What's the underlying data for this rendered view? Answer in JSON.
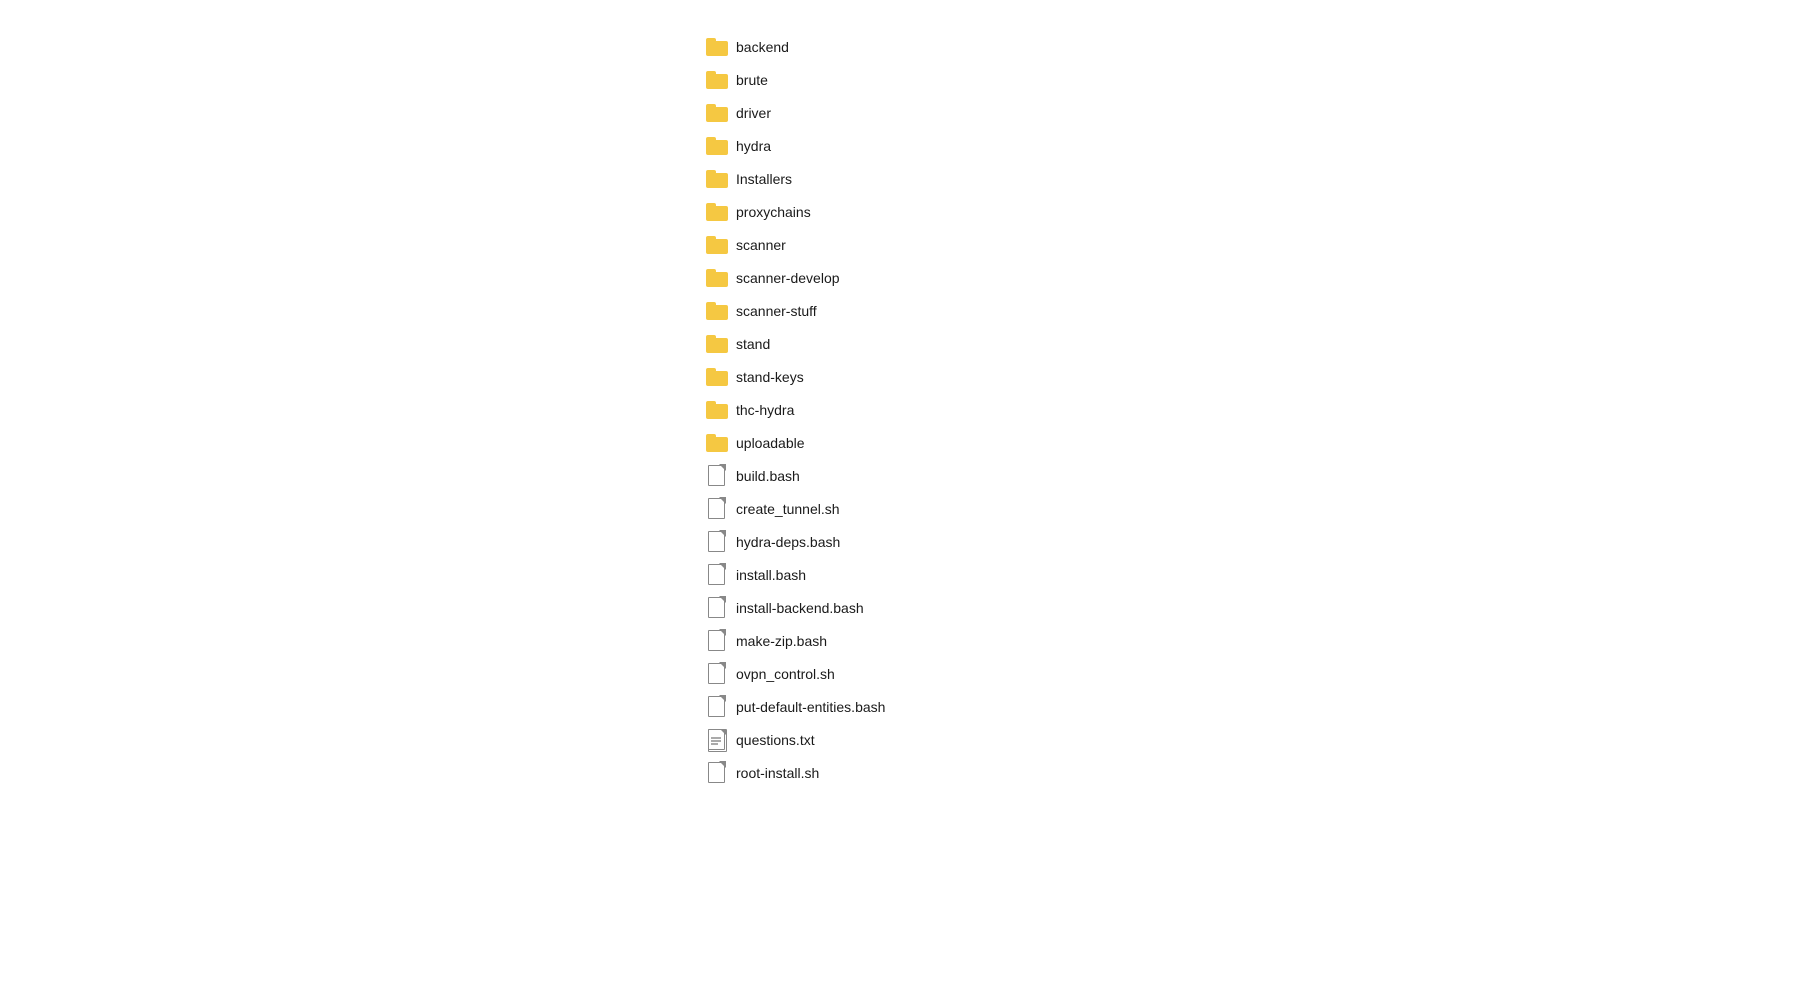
{
  "fileList": {
    "items": [
      {
        "name": "backend",
        "type": "folder"
      },
      {
        "name": "brute",
        "type": "folder"
      },
      {
        "name": "driver",
        "type": "folder"
      },
      {
        "name": "hydra",
        "type": "folder"
      },
      {
        "name": "Installers",
        "type": "folder"
      },
      {
        "name": "proxychains",
        "type": "folder"
      },
      {
        "name": "scanner",
        "type": "folder"
      },
      {
        "name": "scanner-develop",
        "type": "folder"
      },
      {
        "name": "scanner-stuff",
        "type": "folder"
      },
      {
        "name": "stand",
        "type": "folder"
      },
      {
        "name": "stand-keys",
        "type": "folder"
      },
      {
        "name": "thc-hydra",
        "type": "folder"
      },
      {
        "name": "uploadable",
        "type": "folder"
      },
      {
        "name": "build.bash",
        "type": "file"
      },
      {
        "name": "create_tunnel.sh",
        "type": "file"
      },
      {
        "name": "hydra-deps.bash",
        "type": "file"
      },
      {
        "name": "install.bash",
        "type": "file"
      },
      {
        "name": "install-backend.bash",
        "type": "file"
      },
      {
        "name": "make-zip.bash",
        "type": "file"
      },
      {
        "name": "ovpn_control.sh",
        "type": "file"
      },
      {
        "name": "put-default-entities.bash",
        "type": "file"
      },
      {
        "name": "questions.txt",
        "type": "textfile"
      },
      {
        "name": "root-install.sh",
        "type": "file"
      }
    ]
  }
}
